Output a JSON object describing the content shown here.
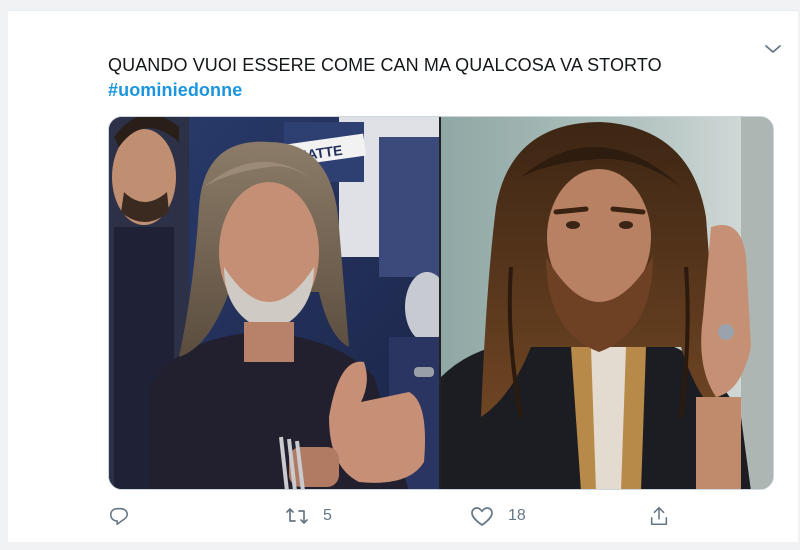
{
  "tweet": {
    "text": "QUANDO VUOI ESSERE COME CAN MA QUALCOSA VA STORTO",
    "hashtag": "#uominiedonne",
    "media": {
      "left_image": "older-long-haired-man-audience-photo",
      "right_image": "young-long-haired-bearded-man-photo",
      "left_sign_text": "MATTE"
    }
  },
  "actions": {
    "reply_count": "",
    "retweet_count": "5",
    "like_count": "18"
  },
  "icons": {
    "menu": "chevron-down-icon",
    "reply": "reply-icon",
    "retweet": "retweet-icon",
    "like": "heart-icon",
    "share": "share-icon"
  },
  "colors": {
    "text": "#14171a",
    "hashtag": "#1b95e0",
    "icon": "#657786",
    "border": "#ccd6dd"
  }
}
